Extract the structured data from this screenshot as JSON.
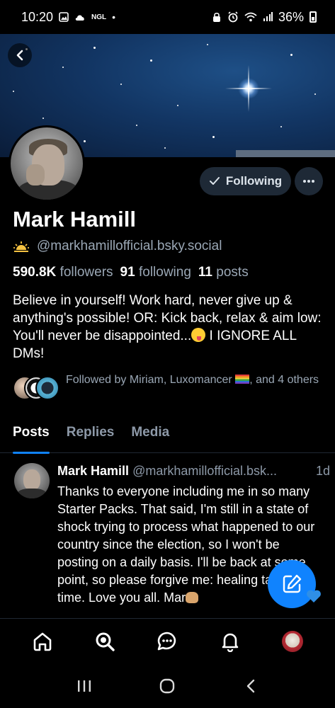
{
  "status_bar": {
    "time": "10:20",
    "small_label": "NGL",
    "dot": "•",
    "battery": "36%"
  },
  "profile": {
    "display_name": "Mark Hamill",
    "handle": "@markhamillofficial.bsky.social",
    "following_button": "Following",
    "stats": {
      "followers_count": "590.8K",
      "followers_label": "followers",
      "following_count": "91",
      "following_label": "following",
      "posts_count": "11",
      "posts_label": "posts"
    },
    "bio_text": "Believe in yourself! Work hard, never give up & anything's possible! OR: Kick back, relax & aim low: You'll never be disappointed...",
    "bio_tail": " I IGNORE ALL DMs!",
    "followed_by_prefix": "Followed by Miriam, Luxomancer ",
    "followed_by_suffix": ", and 4 others"
  },
  "tabs": [
    {
      "label": "Posts",
      "active": true
    },
    {
      "label": "Replies",
      "active": false
    },
    {
      "label": "Media",
      "active": false
    }
  ],
  "post": {
    "author": "Mark Hamill",
    "handle": "@markhamillofficial.bsk...",
    "time": "1d",
    "text": "Thanks to everyone including me in so many Starter Packs. That said, I'm still in a state of shock trying to process what happened to our country since the election, so I won't be posting on a daily basis. I'll be back at some point, so please forgive me: healing takes time. Love you all. Mar"
  },
  "colors": {
    "accent": "#1083fe",
    "background": "#000000",
    "muted_text": "#9aa7b5",
    "button_bg": "#1e2936"
  },
  "icons": {
    "back": "chevron-left-icon",
    "check": "check-icon",
    "more": "ellipsis-icon",
    "handle_badge": "sunrise-icon",
    "compose": "pencil-square-icon",
    "nav": [
      "home-icon",
      "search-icon",
      "chat-icon",
      "bell-icon",
      "avatar"
    ],
    "system": [
      "recents-icon",
      "home-circle-icon",
      "back-chevron-icon"
    ]
  }
}
